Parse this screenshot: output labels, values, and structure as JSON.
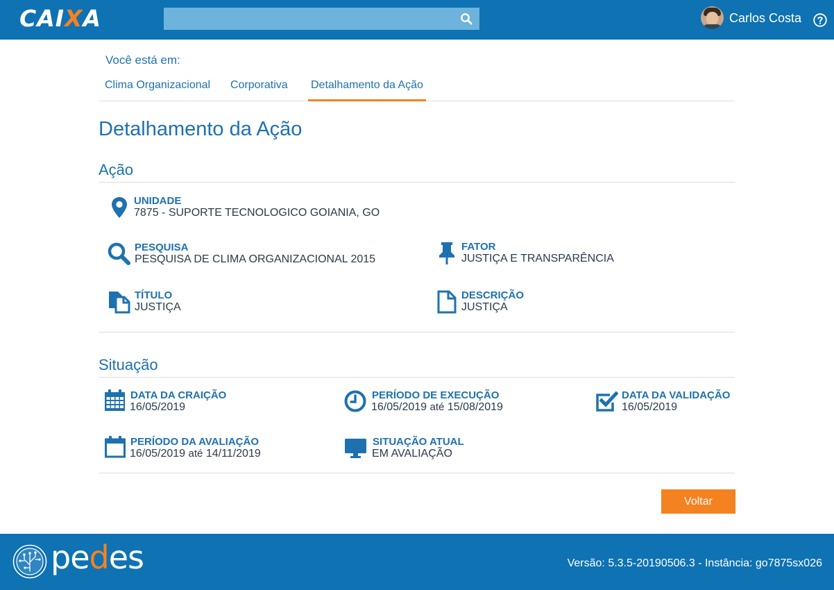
{
  "header": {
    "logo_text_pre": "CAI",
    "logo_text_x": "X",
    "logo_text_post": "A",
    "search_placeholder": "",
    "user_name": "Carlos Costa"
  },
  "breadcrumb": {
    "prefix": "Você está em:",
    "items": [
      {
        "label": "Clima Organizacional"
      },
      {
        "label": "Corporativa"
      },
      {
        "label": "Detalhamento da Ação",
        "active": true
      }
    ]
  },
  "page": {
    "title": "Detalhamento da Ação"
  },
  "acao": {
    "title": "Ação",
    "unidade": {
      "label": "UNIDADE",
      "value": "7875 - SUPORTE TECNOLOGICO GOIANIA, GO",
      "icon": "map-marker-icon"
    },
    "pesquisa": {
      "label": "PESQUISA",
      "value": "PESQUISA DE CLIMA ORGANIZACIONAL 2015",
      "icon": "search-icon"
    },
    "fator": {
      "label": "FATOR",
      "value": "JUSTIÇA E TRANSPARÊNCIA",
      "icon": "pushpin-icon"
    },
    "titulo": {
      "label": "TÍTULO",
      "value": "JUSTIÇA",
      "icon": "copy-icon"
    },
    "descricao": {
      "label": "DESCRIÇÃO",
      "value": "JUSTIÇA",
      "icon": "file-icon"
    }
  },
  "situacao": {
    "title": "Situação",
    "data_criacao": {
      "label": "DATA DA CRAIÇÃO",
      "value": "16/05/2019",
      "icon": "calendar-grid-icon"
    },
    "periodo_execucao": {
      "label": "PERÍODO DE EXECUÇÃO",
      "start": "16/05/2019",
      "joiner": "até",
      "end": "15/08/2019",
      "icon": "clock-icon"
    },
    "data_validacao": {
      "label": "DATA DA VALIDAÇÃO",
      "value": "16/05/2019",
      "icon": "check-square-icon"
    },
    "periodo_avaliacao": {
      "label": "PERÍODO DA AVALIAÇÃO",
      "start": "16/05/2019",
      "joiner": "até",
      "end": "14/11/2019",
      "icon": "calendar-icon"
    },
    "situacao_atual": {
      "label": "SITUAÇÃO ATUAL",
      "value": "EM AVALIAÇÃO",
      "icon": "monitor-icon"
    }
  },
  "actions": {
    "back_label": "Voltar"
  },
  "footer": {
    "brand_pre": "pe",
    "brand_mid": "d",
    "brand_post": "es",
    "version": "Versão: 5.3.5-20190506.3 - Instância: go7875sx026"
  },
  "colors": {
    "primary": "#0e72b3",
    "accent": "#f58220",
    "text_blue": "#1e71b0"
  }
}
